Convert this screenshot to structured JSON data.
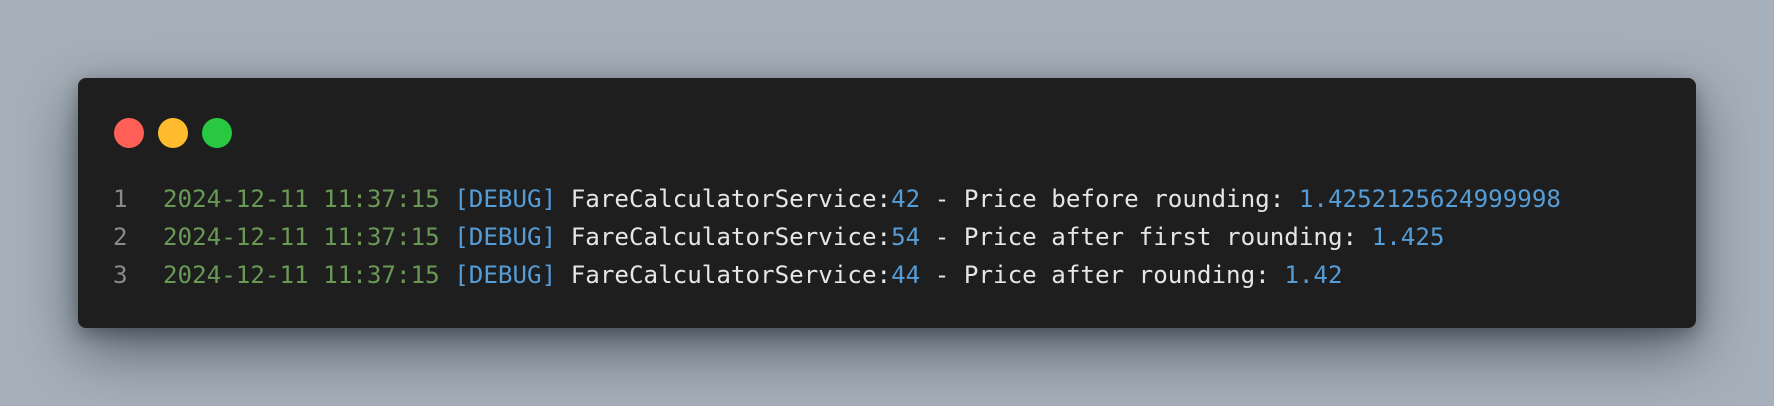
{
  "window": {
    "controls": [
      {
        "name": "close",
        "color": "#ff5f57"
      },
      {
        "name": "minimize",
        "color": "#febc2e"
      },
      {
        "name": "maximize",
        "color": "#28c840"
      }
    ]
  },
  "colors": {
    "timestamp": "#6a9955",
    "level": "#569cd6",
    "number": "#569cd6",
    "text": "#e6e6e6",
    "line_number": "#8a8a8a",
    "background": "#1e1e1e"
  },
  "lines": [
    {
      "number": "1",
      "timestamp": "2024-12-11 11:37:15",
      "level": "[DEBUG]",
      "class": "FareCalculatorService:",
      "line": "42",
      "message": " - Price before rounding: ",
      "value": "1.4252125624999998"
    },
    {
      "number": "2",
      "timestamp": "2024-12-11 11:37:15",
      "level": "[DEBUG]",
      "class": "FareCalculatorService:",
      "line": "54",
      "message": " - Price after first rounding: ",
      "value": "1.425"
    },
    {
      "number": "3",
      "timestamp": "2024-12-11 11:37:15",
      "level": "[DEBUG]",
      "class": "FareCalculatorService:",
      "line": "44",
      "message": " - Price after rounding: ",
      "value": "1.42"
    }
  ]
}
